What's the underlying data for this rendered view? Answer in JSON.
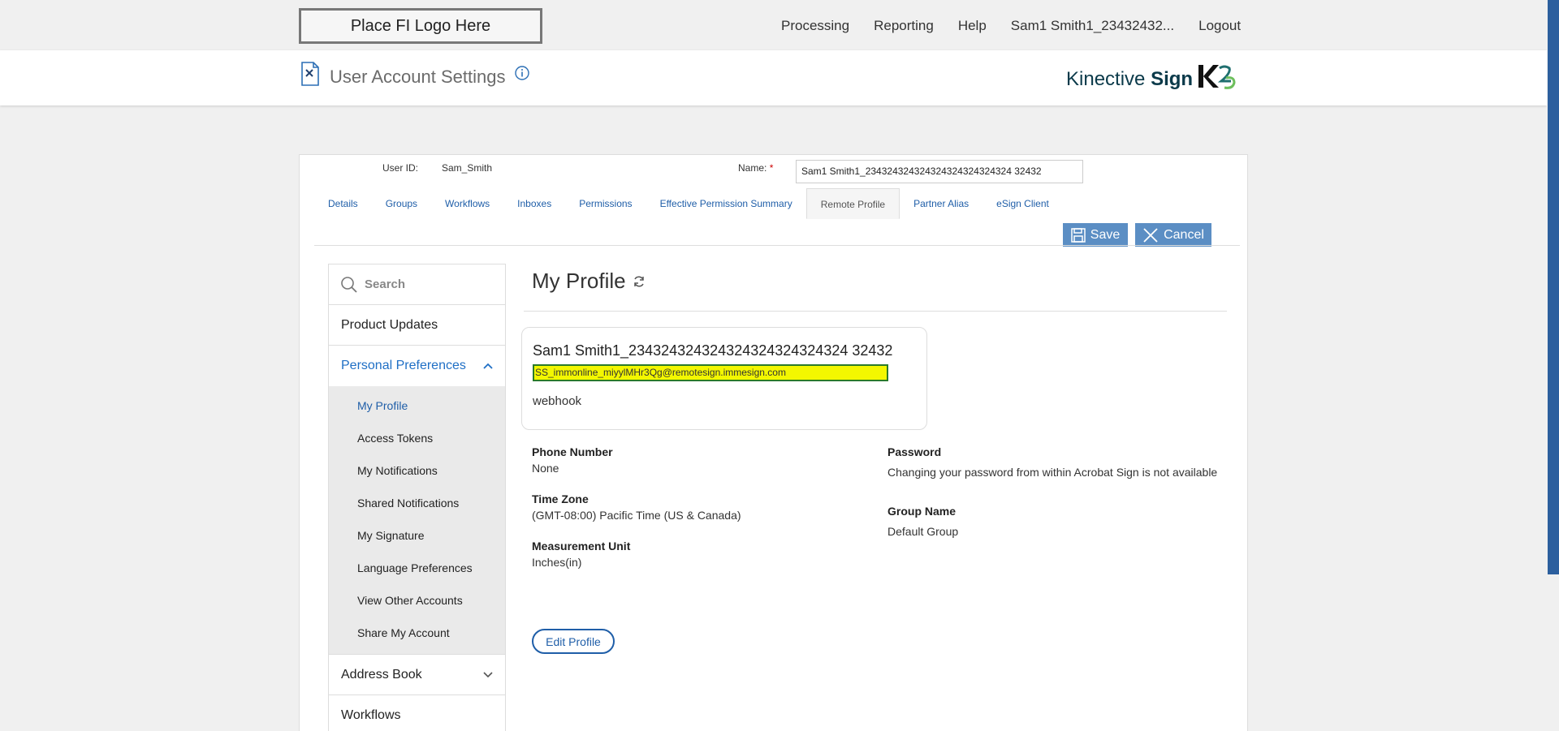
{
  "topbar": {
    "logo": "Place FI Logo Here",
    "nav": [
      "Processing",
      "Reporting",
      "Help",
      "Sam1 Smith1_23432432...",
      "Logout"
    ]
  },
  "header": {
    "title": "User Account Settings",
    "brand_light": "Kinective",
    "brand_bold": "Sign"
  },
  "user": {
    "id_label": "User ID:",
    "id_value": "Sam_Smith",
    "name_label": "Name:",
    "name_required": "*",
    "name_value": "Sam1 Smith1_234324324324324324324324324 32432"
  },
  "tabs": [
    "Details",
    "Groups",
    "Workflows",
    "Inboxes",
    "Permissions",
    "Effective Permission Summary",
    "Remote Profile",
    "Partner Alias",
    "eSign Client"
  ],
  "active_tab": "Remote Profile",
  "actions": {
    "save": "Save",
    "cancel": "Cancel"
  },
  "leftnav": {
    "search_placeholder": "Search",
    "product_updates": "Product Updates",
    "personal_preferences": "Personal Preferences",
    "sub_items": [
      "My Profile",
      "Access Tokens",
      "My Notifications",
      "Shared Notifications",
      "My Signature",
      "Language Preferences",
      "View Other Accounts",
      "Share My Account"
    ],
    "address_book": "Address Book",
    "workflows": "Workflows"
  },
  "profile": {
    "heading": "My Profile",
    "card_name": "Sam1 Smith1_234324324324324324324324324 32432",
    "card_email": "SS_immonline_miyylMHr3Qg@remotesign.immesign.com",
    "card_note": "webhook",
    "phone_label": "Phone Number",
    "phone_value": "None",
    "tz_label": "Time Zone",
    "tz_value": "(GMT-08:00) Pacific Time (US & Canada)",
    "unit_label": "Measurement Unit",
    "unit_value": "Inches(in)",
    "password_label": "Password",
    "password_value": "Changing your password from within Acrobat Sign is not available",
    "group_label": "Group Name",
    "group_value": "Default Group",
    "edit_button": "Edit Profile"
  },
  "colors": {
    "accent": "#1f5ea8",
    "button": "#5b8ec4",
    "highlight": "#f3f700"
  }
}
